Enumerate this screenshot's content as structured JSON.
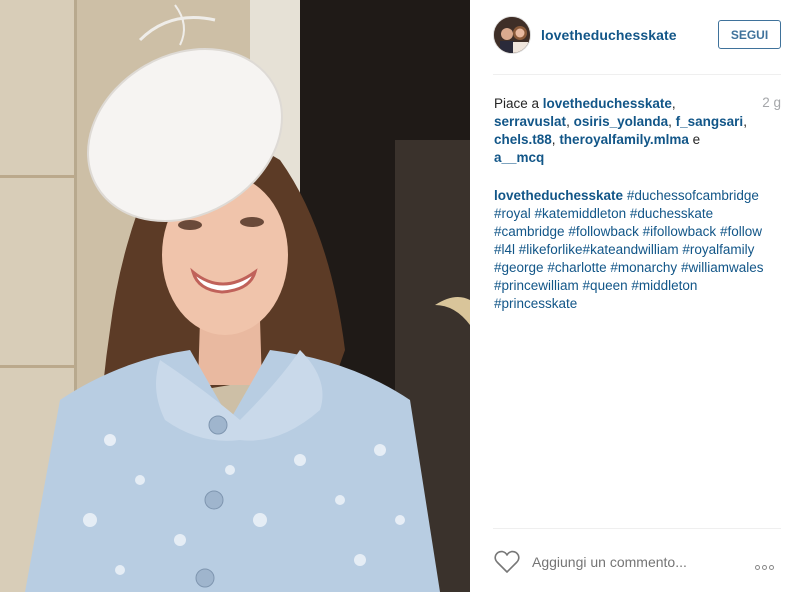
{
  "post": {
    "photo_alt": "photo",
    "username": "lovetheduchesskate",
    "follow_label": "SEGUI",
    "likes_prefix": "Piace a",
    "likers": [
      "lovetheduchesskate",
      "serravuslat",
      "osiris_yolanda",
      "f_sangsari",
      "chels.t88",
      "theroyalfamily.mlma",
      "a__mcq"
    ],
    "likes_conjunction": "e",
    "time_ago": "2 g",
    "caption_author": "lovetheduchesskate",
    "hashtags": [
      "#duchessofcambridge",
      "#royal",
      "#katemiddleton",
      "#duchesskate",
      "#cambridge",
      "#followback",
      "#ifollowback",
      "#follow",
      "#l4l",
      "#likeforlike#kateandwilliam",
      "#royalfamily",
      "#george",
      "#charlotte",
      "#monarchy",
      "#williamwales",
      "#princewilliam",
      "#queen",
      "#middleton",
      "#princesskate"
    ],
    "comment_placeholder": "Aggiungi un commento...",
    "heart_icon": "heart-outline-icon",
    "more_icon": "more-options-icon"
  }
}
